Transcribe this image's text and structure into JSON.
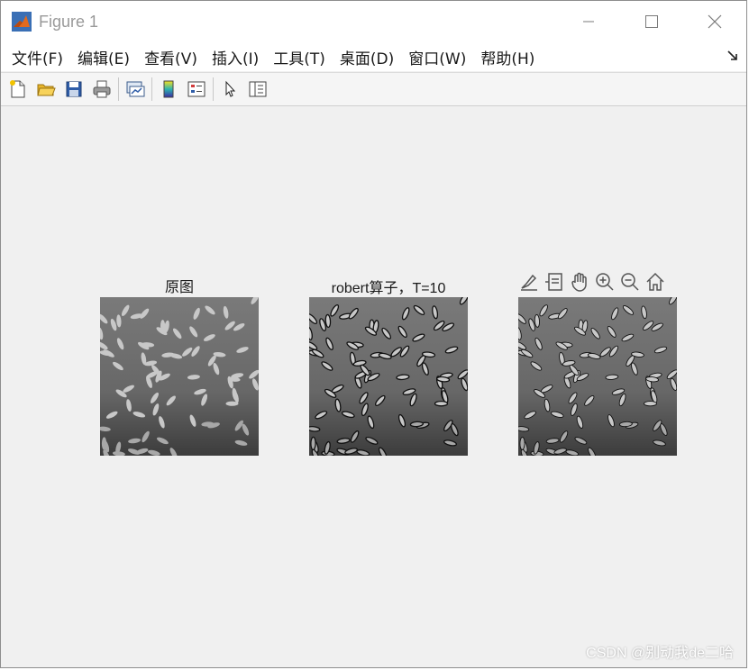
{
  "window": {
    "title": "Figure 1"
  },
  "menu": [
    "文件(F)",
    "编辑(E)",
    "查看(V)",
    "插入(I)",
    "工具(T)",
    "桌面(D)",
    "窗口(W)",
    "帮助(H)"
  ],
  "toolbar": [
    {
      "name": "new-figure-icon"
    },
    {
      "name": "open-file-icon"
    },
    {
      "name": "save-icon"
    },
    {
      "name": "print-icon"
    },
    {
      "name": "link-plot-icon"
    },
    {
      "name": "colorbar-icon"
    },
    {
      "name": "legend-icon"
    },
    {
      "name": "pointer-icon"
    },
    {
      "name": "property-inspector-icon"
    }
  ],
  "axes": [
    {
      "title": "原图",
      "style": "original"
    },
    {
      "title": "robert算子，T=10",
      "style": "edge"
    },
    {
      "title": "",
      "style": "edge2"
    }
  ],
  "axes_toolbar": [
    "brush-icon",
    "data-tips-icon",
    "pan-icon",
    "zoom-in-icon",
    "zoom-out-icon",
    "home-icon"
  ],
  "watermark": "CSDN @别动我de二哈",
  "colors": {
    "image_bg": "#6b6b6b",
    "grain": "#c8c8c8",
    "grain_edge": "#111111"
  }
}
